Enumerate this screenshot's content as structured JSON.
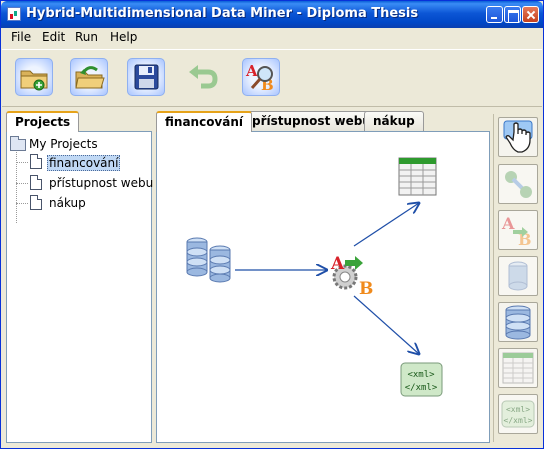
{
  "window": {
    "title": "Hybrid-Multidimensional Data Miner - Diploma Thesis"
  },
  "menu": {
    "items": [
      "File",
      "Edit",
      "Run",
      "Help"
    ]
  },
  "toolbar": {
    "buttons": [
      {
        "icon": "new-project-folder-icon",
        "enabled": true
      },
      {
        "icon": "open-project-folder-icon",
        "enabled": true
      },
      {
        "icon": "save-floppy-icon",
        "enabled": true
      },
      {
        "icon": "undo-arrow-icon",
        "enabled": false
      },
      {
        "icon": "transform-search-icon",
        "enabled": true
      }
    ]
  },
  "left_panel": {
    "tab_label": "Projects",
    "tree": {
      "root": "My Projects",
      "children": [
        "financování",
        "přístupnost webu",
        "nákup"
      ],
      "selected": "financování"
    }
  },
  "editor": {
    "tabs": [
      "financování",
      "přístupnost webu",
      "nákup"
    ],
    "active_tab": "financování",
    "nodes": {
      "source": "database-icon",
      "transform": "transform-ab-gears-icon",
      "table_output": "table-grid-icon",
      "xml_output": "xml-output-icon",
      "xml_text_open": "<xml>",
      "xml_text_close": "</xml>"
    }
  },
  "palette": {
    "items": [
      {
        "icon": "hand-pointer-icon",
        "enabled": true
      },
      {
        "icon": "connect-arrow-icon",
        "enabled": false
      },
      {
        "icon": "transform-ab-icon",
        "enabled": false
      },
      {
        "icon": "single-database-icon",
        "enabled": false
      },
      {
        "icon": "database-stack-icon",
        "enabled": true
      },
      {
        "icon": "table-grid-icon",
        "enabled": false
      },
      {
        "icon": "xml-output-icon",
        "enabled": false
      }
    ],
    "xml_text_open": "<xml>",
    "xml_text_close": "</xml>"
  }
}
